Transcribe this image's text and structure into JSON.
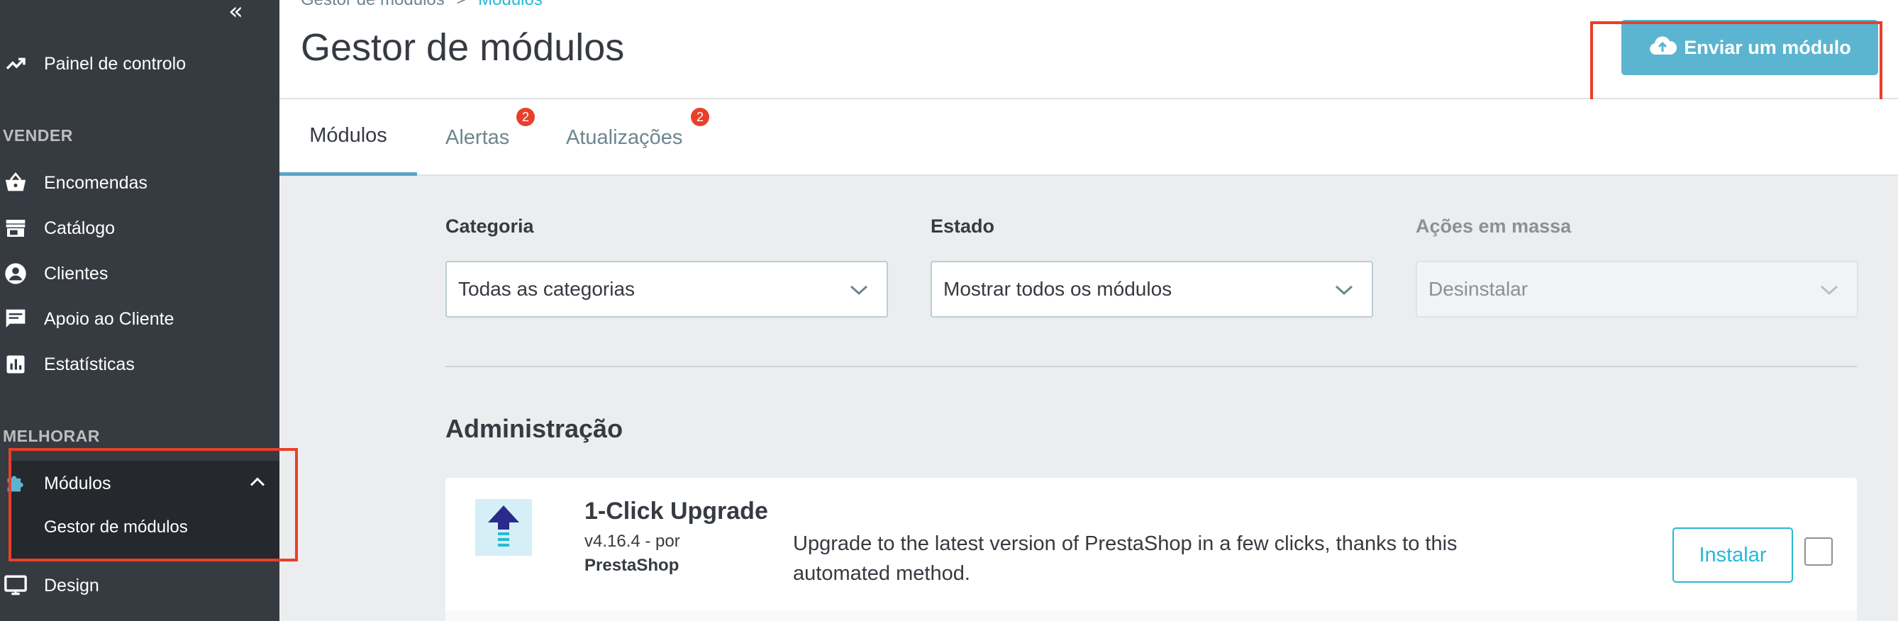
{
  "sidebar": {
    "collapse_icon": "«",
    "dashboard": "Painel de controlo",
    "section_sell": "VENDER",
    "items_sell": [
      {
        "label": "Encomendas",
        "icon": "basket-icon"
      },
      {
        "label": "Catálogo",
        "icon": "store-icon"
      },
      {
        "label": "Clientes",
        "icon": "user-circle-icon"
      },
      {
        "label": "Apoio ao Cliente",
        "icon": "chat-icon"
      },
      {
        "label": "Estatísticas",
        "icon": "bar-chart-icon"
      }
    ],
    "section_improve": "MELHORAR",
    "modules": "Módulos",
    "modules_sub": "Gestor de módulos",
    "design": "Design"
  },
  "header": {
    "breadcrumb_parent": "Gestor de módulos",
    "breadcrumb_sep": ">",
    "breadcrumb_current": "Módulos",
    "title": "Gestor de módulos",
    "upload_button": "Enviar um módulo"
  },
  "tabs": [
    {
      "label": "Módulos",
      "badge": ""
    },
    {
      "label": "Alertas",
      "badge": "2"
    },
    {
      "label": "Atualizações",
      "badge": "2"
    }
  ],
  "filters": {
    "category_label": "Categoria",
    "category_value": "Todas as categorias",
    "status_label": "Estado",
    "status_value": "Mostrar todos os módulos",
    "bulk_label": "Ações em massa",
    "bulk_value": "Desinstalar"
  },
  "section": {
    "title": "Administração"
  },
  "module": {
    "name": "1-Click Upgrade",
    "version": "v4.16.4 - por",
    "author": "PrestaShop",
    "description": "Upgrade to the latest version of PrestaShop in a few clicks, thanks to this automated method.",
    "install_button": "Instalar"
  },
  "colors": {
    "sidebar_bg": "#363a41",
    "accent": "#25b9d7",
    "upload_bg": "#5bb5d0",
    "highlight": "#e8402a"
  }
}
